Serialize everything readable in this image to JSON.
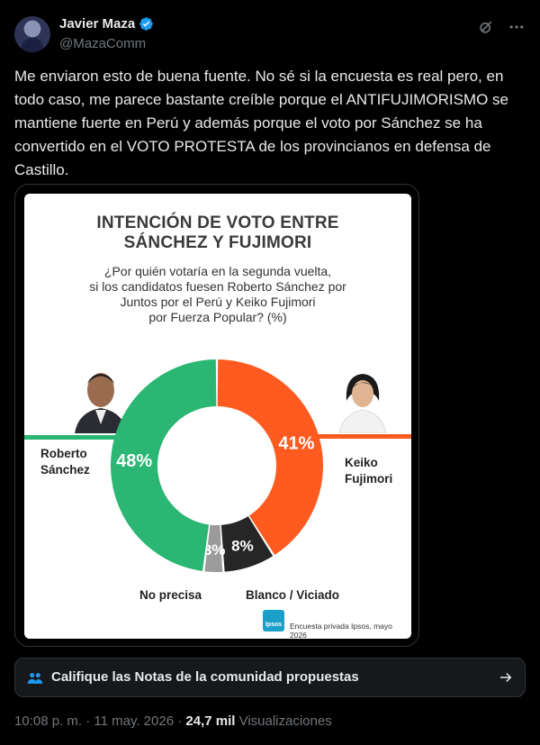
{
  "author": {
    "name": "Javier Maza",
    "handle": "@MazaComm"
  },
  "tweet": {
    "text": "Me enviaron esto de buena fuente. No sé si la encuesta es real pero, en todo caso, me parece bastante creíble porque el ANTIFUJIMORISMO se mantiene fuerte en Perú y además porque el voto por Sánchez se ha convertido en el VOTO PROTESTA de los provincianos en defensa de Castillo."
  },
  "media": {
    "title_line1": "INTENCIÓN DE VOTO ENTRE",
    "title_line2": "SÁNCHEZ Y FUJIMORI",
    "question_lines": [
      "¿Por quién votaría en la segunda vuelta,",
      "si los candidatos fuesen Roberto Sánchez por",
      "Juntos por el Perú y Keiko Fujimori",
      "por Fuerza Popular? (%)"
    ],
    "footer": "Encuesta privada Ipsos, mayo 2026",
    "ipsos_logo": "Ipsos"
  },
  "chart_data": {
    "type": "pie",
    "title": "INTENCIÓN DE VOTO ENTRE SÁNCHEZ Y FUJIMORI",
    "subtitle": "¿Por quién votaría en la segunda vuelta, si los candidatos fuesen Roberto Sánchez por Juntos por el Perú y Keiko Fujimori por Fuerza Popular? (%)",
    "categories": [
      "Roberto Sánchez",
      "Keiko Fujimori",
      "Blanco / Viciado",
      "No precisa"
    ],
    "values": [
      48,
      41,
      8,
      3
    ],
    "value_labels": [
      "48%",
      "41%",
      "8%",
      "3%"
    ],
    "colors": [
      "#2bb673",
      "#ff5a1f",
      "#262626",
      "#9b9b9b"
    ],
    "labels_display": {
      "sanchez": [
        "Roberto",
        "Sánchez"
      ],
      "fujimori": [
        "Keiko",
        "Fujimori"
      ],
      "blanco": "Blanco / Viciado",
      "noprecisa": "No precisa"
    }
  },
  "community_notes": {
    "label": "Califique las Notas de la comunidad propuestas"
  },
  "meta": {
    "time": "10:08 p. m. · 11 may. 2026 · ",
    "views_count": "24,7 mil",
    "views_label": " Visualizaciones"
  },
  "icons": {
    "verified": "verified-badge-icon",
    "grok": "grok-icon",
    "more": "more-icon",
    "notes": "people-icon",
    "arrow": "arrow-right-icon"
  }
}
